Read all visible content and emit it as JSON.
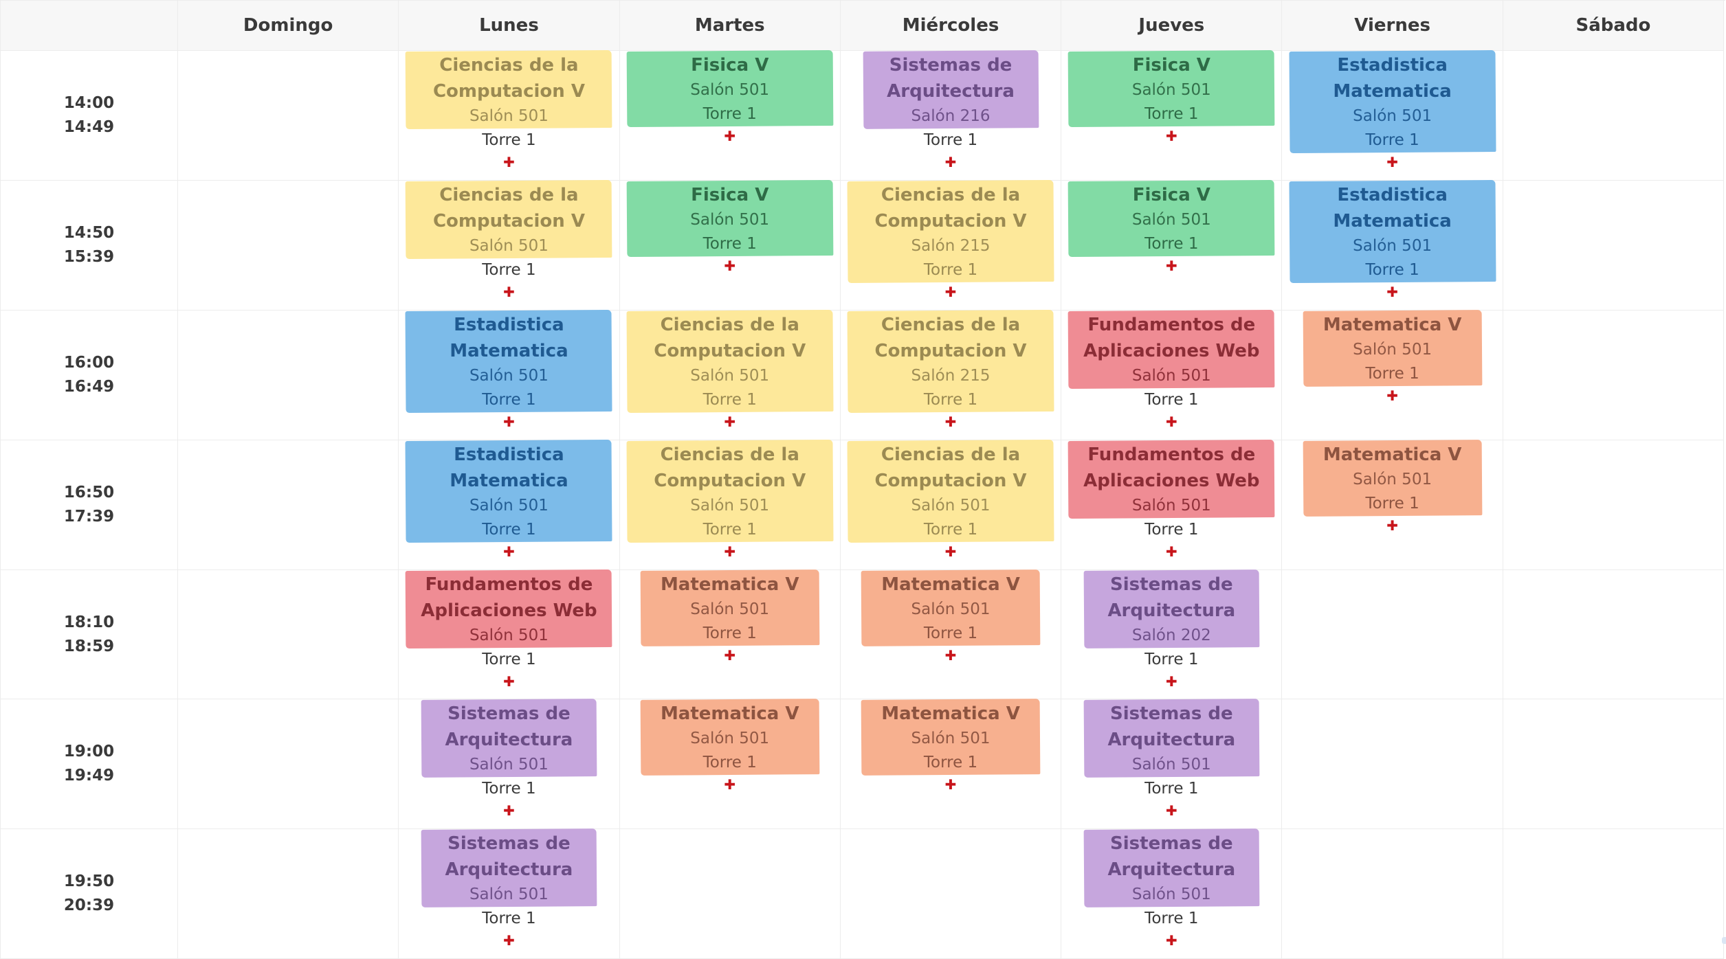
{
  "days": [
    "Domingo",
    "Lunes",
    "Martes",
    "Miércoles",
    "Jueves",
    "Viernes",
    "Sábado"
  ],
  "time_slots": [
    {
      "start": "14:00",
      "end": "14:49"
    },
    {
      "start": "14:50",
      "end": "15:39"
    },
    {
      "start": "16:00",
      "end": "16:49"
    },
    {
      "start": "16:50",
      "end": "17:39"
    },
    {
      "start": "18:10",
      "end": "18:59"
    },
    {
      "start": "19:00",
      "end": "19:49"
    },
    {
      "start": "19:50",
      "end": "20:39"
    }
  ],
  "add_icon": "plus-icon",
  "colors": {
    "yellow": "#fde89a",
    "green": "#82dba5",
    "purple": "#c6a6dd",
    "blue": "#7cbbe9",
    "red": "#ef8c94",
    "orange": "#f7b08f",
    "add_icon": "#c8151b"
  },
  "grid": [
    [
      null,
      {
        "subject": "Ciencias de la Computacion V",
        "room": "Salón 501",
        "tower": "Torre 1",
        "color": "yellow",
        "tower_outside": true
      },
      {
        "subject": "Fisica V",
        "room": "Salón 501",
        "tower": "Torre 1",
        "color": "green",
        "tower_outside": false
      },
      {
        "subject": "Sistemas de Arquitectura",
        "room": "Salón 216",
        "tower": "Torre 1",
        "color": "purple",
        "tower_outside": true
      },
      {
        "subject": "Fisica V",
        "room": "Salón 501",
        "tower": "Torre 1",
        "color": "green",
        "tower_outside": false
      },
      {
        "subject": "Estadistica Matematica",
        "room": "Salón 501",
        "tower": "Torre 1",
        "color": "blue",
        "tower_outside": false
      },
      null
    ],
    [
      null,
      {
        "subject": "Ciencias de la Computacion V",
        "room": "Salón 501",
        "tower": "Torre 1",
        "color": "yellow",
        "tower_outside": true
      },
      {
        "subject": "Fisica V",
        "room": "Salón 501",
        "tower": "Torre 1",
        "color": "green",
        "tower_outside": false
      },
      {
        "subject": "Ciencias de la Computacion V",
        "room": "Salón 215",
        "tower": "Torre 1",
        "color": "yellow",
        "tower_outside": false
      },
      {
        "subject": "Fisica V",
        "room": "Salón 501",
        "tower": "Torre 1",
        "color": "green",
        "tower_outside": false
      },
      {
        "subject": "Estadistica Matematica",
        "room": "Salón 501",
        "tower": "Torre 1",
        "color": "blue",
        "tower_outside": false
      },
      null
    ],
    [
      null,
      {
        "subject": "Estadistica Matematica",
        "room": "Salón 501",
        "tower": "Torre 1",
        "color": "blue",
        "tower_outside": false
      },
      {
        "subject": "Ciencias de la Computacion V",
        "room": "Salón 501",
        "tower": "Torre 1",
        "color": "yellow",
        "tower_outside": false
      },
      {
        "subject": "Ciencias de la Computacion V",
        "room": "Salón 215",
        "tower": "Torre 1",
        "color": "yellow",
        "tower_outside": false
      },
      {
        "subject": "Fundamentos de Aplicaciones Web",
        "room": "Salón 501",
        "tower": "Torre 1",
        "color": "red",
        "tower_outside": true
      },
      {
        "subject": "Matematica V",
        "room": "Salón 501",
        "tower": "Torre 1",
        "color": "orange",
        "tower_outside": false
      },
      null
    ],
    [
      null,
      {
        "subject": "Estadistica Matematica",
        "room": "Salón 501",
        "tower": "Torre 1",
        "color": "blue",
        "tower_outside": false
      },
      {
        "subject": "Ciencias de la Computacion V",
        "room": "Salón 501",
        "tower": "Torre 1",
        "color": "yellow",
        "tower_outside": false
      },
      {
        "subject": "Ciencias de la Computacion V",
        "room": "Salón 501",
        "tower": "Torre 1",
        "color": "yellow",
        "tower_outside": false
      },
      {
        "subject": "Fundamentos de Aplicaciones Web",
        "room": "Salón 501",
        "tower": "Torre 1",
        "color": "red",
        "tower_outside": true
      },
      {
        "subject": "Matematica V",
        "room": "Salón 501",
        "tower": "Torre 1",
        "color": "orange",
        "tower_outside": false
      },
      null
    ],
    [
      null,
      {
        "subject": "Fundamentos de Aplicaciones Web",
        "room": "Salón 501",
        "tower": "Torre 1",
        "color": "red",
        "tower_outside": true
      },
      {
        "subject": "Matematica V",
        "room": "Salón 501",
        "tower": "Torre 1",
        "color": "orange",
        "tower_outside": false
      },
      {
        "subject": "Matematica V",
        "room": "Salón 501",
        "tower": "Torre 1",
        "color": "orange",
        "tower_outside": false
      },
      {
        "subject": "Sistemas de Arquitectura",
        "room": "Salón 202",
        "tower": "Torre 1",
        "color": "purple",
        "tower_outside": true
      },
      null,
      null
    ],
    [
      null,
      {
        "subject": "Sistemas de Arquitectura",
        "room": "Salón 501",
        "tower": "Torre 1",
        "color": "purple",
        "tower_outside": true
      },
      {
        "subject": "Matematica V",
        "room": "Salón 501",
        "tower": "Torre 1",
        "color": "orange",
        "tower_outside": false
      },
      {
        "subject": "Matematica V",
        "room": "Salón 501",
        "tower": "Torre 1",
        "color": "orange",
        "tower_outside": false
      },
      {
        "subject": "Sistemas de Arquitectura",
        "room": "Salón 501",
        "tower": "Torre 1",
        "color": "purple",
        "tower_outside": true
      },
      null,
      null
    ],
    [
      null,
      {
        "subject": "Sistemas de Arquitectura",
        "room": "Salón 501",
        "tower": "Torre 1",
        "color": "purple",
        "tower_outside": true
      },
      null,
      null,
      {
        "subject": "Sistemas de Arquitectura",
        "room": "Salón 501",
        "tower": "Torre 1",
        "color": "purple",
        "tower_outside": true
      },
      null,
      null
    ]
  ]
}
